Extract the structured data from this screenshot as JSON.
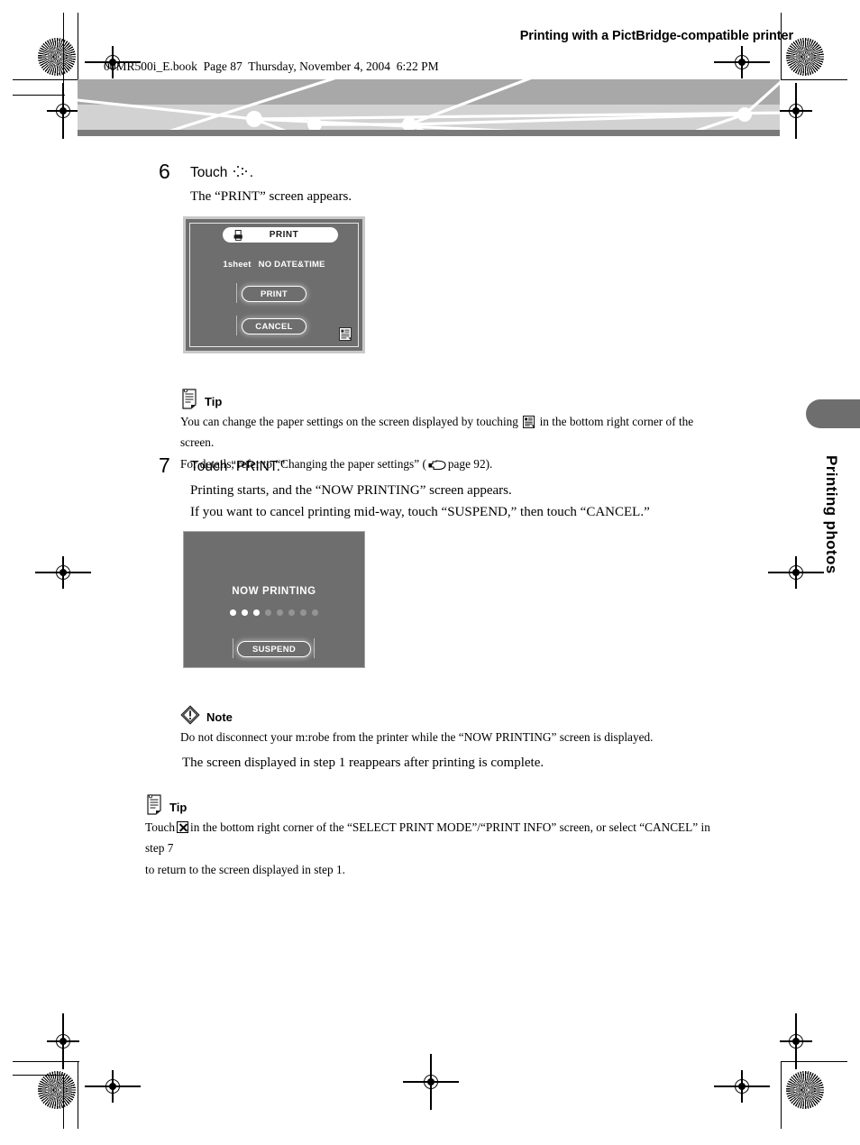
{
  "header": {
    "file_line": "00MR500i_E.book  Page 87  Thursday, November 4, 2004  6:22 PM",
    "title": "Printing with a PictBridge-compatible printer"
  },
  "side_tab": {
    "label": "Printing photos"
  },
  "steps": [
    {
      "number": "6",
      "head_prefix": "Touch",
      "head_suffix": ".",
      "head_icon": "four-arrow-dots-icon",
      "body": "The “PRINT” screen appears."
    },
    {
      "number": "7",
      "head": "Touch “PRINT.”",
      "body_lines": [
        "Printing starts, and the “NOW PRINTING” screen appears.",
        "If you want to cancel printing mid-way, touch “SUSPEND,” then touch “CANCEL.”"
      ]
    }
  ],
  "print_screen": {
    "title": "PRINT",
    "title_icon": "printer-icon",
    "sheet_count": "1sheet",
    "date_mode": "NO DATE&TIME",
    "buttons": [
      {
        "label": "PRINT"
      },
      {
        "label": "CANCEL"
      }
    ],
    "corner_icon": "paper-settings-icon"
  },
  "printing_screen": {
    "title": "NOW PRINTING",
    "progress_dots_total": 8,
    "progress_dots_active": 3,
    "button_label": "SUSPEND"
  },
  "tip_1": {
    "label": "Tip",
    "icon": "tip-note-icon",
    "line1_a": "You can change the paper settings on the screen displayed by touching",
    "line1_icon": "paper-settings-icon",
    "line1_b": "in the bottom right corner of the screen.",
    "line2_a": "For details, refer to “Changing the paper settings” (",
    "line2_icon": "pointing-hand-icon",
    "line2_b": "page 92)."
  },
  "note_1": {
    "label": "Note",
    "icon": "warning-diamond-icon",
    "body": "Do not disconnect your m:robe from the printer while the “NOW PRINTING” screen is displayed."
  },
  "standalone_note": "The screen displayed in step 1 reappears after printing is complete.",
  "tip_2": {
    "label": "Tip",
    "icon": "tip-note-icon",
    "line1_a": "Touch",
    "line1_icon": "x-box-icon",
    "line1_b": "in the bottom right corner of the “SELECT PRINT MODE”/“PRINT INFO” screen, or select “CANCEL” in step 7",
    "line2": "to return to the screen displayed in step 1."
  },
  "page_number": "87",
  "colors": {
    "band_top": "#a8a8a8",
    "band_bottom": "#d2d2d2",
    "band_rule": "#7a7a7a",
    "screen_bg": "#6e6e6e",
    "tab_gray": "#6e6e6e"
  }
}
